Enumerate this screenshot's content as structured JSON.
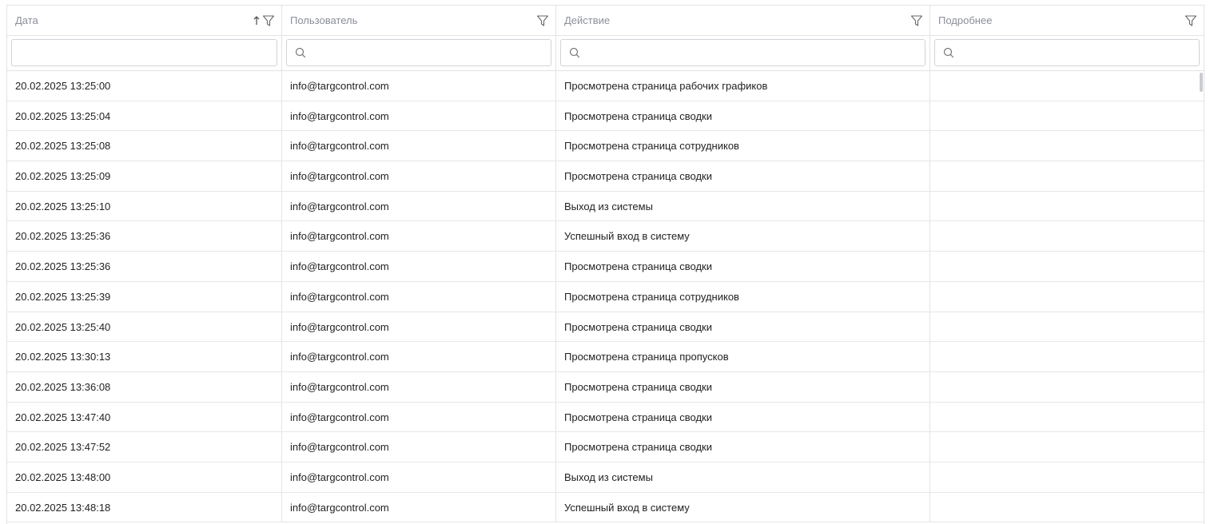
{
  "columns": [
    {
      "label": "Дата"
    },
    {
      "label": "Пользователь"
    },
    {
      "label": "Действие"
    },
    {
      "label": "Подробнее"
    }
  ],
  "filters": {
    "date_value": "",
    "user_value": "",
    "action_value": "",
    "details_value": ""
  },
  "rows": [
    {
      "date": "20.02.2025 13:25:00",
      "user": "info@targcontrol.com",
      "action": "Просмотрена страница рабочих графиков",
      "details": ""
    },
    {
      "date": "20.02.2025 13:25:04",
      "user": "info@targcontrol.com",
      "action": "Просмотрена страница сводки",
      "details": ""
    },
    {
      "date": "20.02.2025 13:25:08",
      "user": "info@targcontrol.com",
      "action": "Просмотрена страница сотрудников",
      "details": ""
    },
    {
      "date": "20.02.2025 13:25:09",
      "user": "info@targcontrol.com",
      "action": "Просмотрена страница сводки",
      "details": ""
    },
    {
      "date": "20.02.2025 13:25:10",
      "user": "info@targcontrol.com",
      "action": "Выход из системы",
      "details": ""
    },
    {
      "date": "20.02.2025 13:25:36",
      "user": "info@targcontrol.com",
      "action": "Успешный вход в систему",
      "details": ""
    },
    {
      "date": "20.02.2025 13:25:36",
      "user": "info@targcontrol.com",
      "action": "Просмотрена страница сводки",
      "details": ""
    },
    {
      "date": "20.02.2025 13:25:39",
      "user": "info@targcontrol.com",
      "action": "Просмотрена страница сотрудников",
      "details": ""
    },
    {
      "date": "20.02.2025 13:25:40",
      "user": "info@targcontrol.com",
      "action": "Просмотрена страница сводки",
      "details": ""
    },
    {
      "date": "20.02.2025 13:30:13",
      "user": "info@targcontrol.com",
      "action": "Просмотрена страница пропусков",
      "details": ""
    },
    {
      "date": "20.02.2025 13:36:08",
      "user": "info@targcontrol.com",
      "action": "Просмотрена страница сводки",
      "details": ""
    },
    {
      "date": "20.02.2025 13:47:40",
      "user": "info@targcontrol.com",
      "action": "Просмотрена страница сводки",
      "details": ""
    },
    {
      "date": "20.02.2025 13:47:52",
      "user": "info@targcontrol.com",
      "action": "Просмотрена страница сводки",
      "details": ""
    },
    {
      "date": "20.02.2025 13:48:00",
      "user": "info@targcontrol.com",
      "action": "Выход из системы",
      "details": ""
    },
    {
      "date": "20.02.2025 13:48:18",
      "user": "info@targcontrol.com",
      "action": "Успешный вход в систему",
      "details": ""
    }
  ],
  "sort": {
    "column": "date",
    "direction": "ascending"
  },
  "icons": {
    "sort": "sort-arrow-up-icon",
    "filter": "filter-funnel-icon",
    "search": "search-icon"
  },
  "colors": {
    "header_text": "#8a8f98",
    "border": "#e3e3e3",
    "cell_text": "#222222"
  }
}
